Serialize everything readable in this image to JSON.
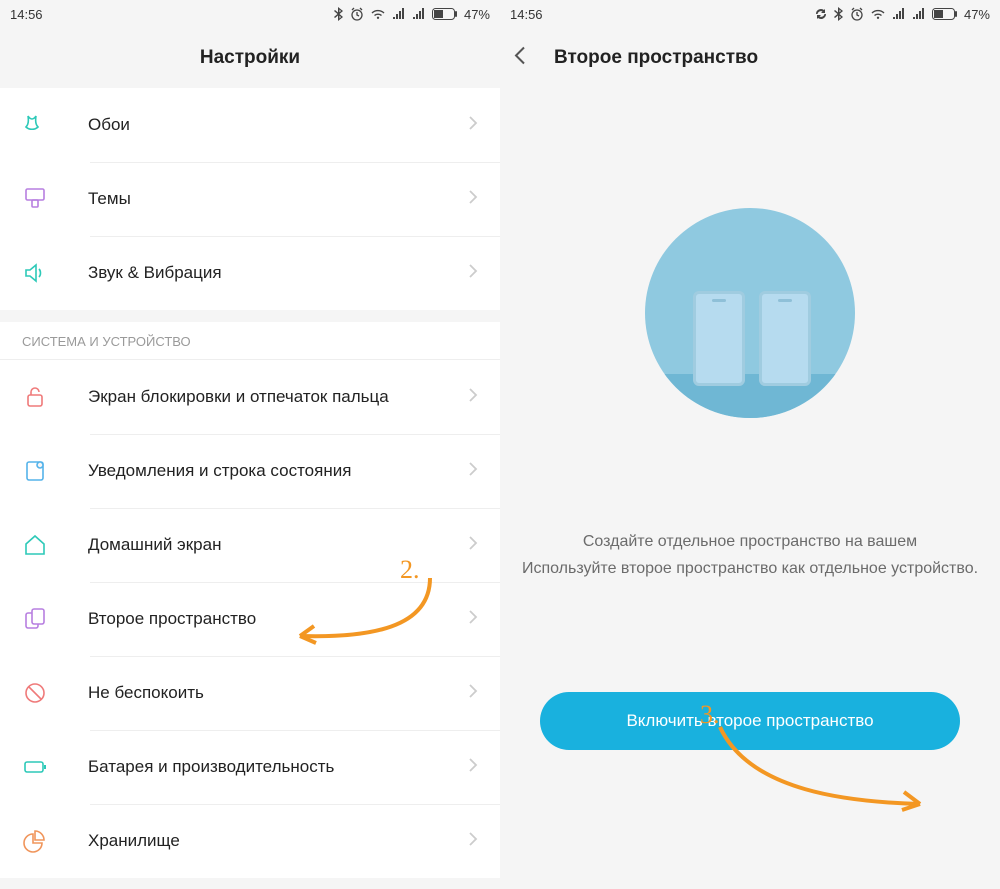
{
  "left": {
    "status": {
      "time": "14:56",
      "battery": "47%"
    },
    "title": "Настройки",
    "items_top": [
      {
        "label": "Обои",
        "icon": "wallpaper"
      },
      {
        "label": "Темы",
        "icon": "themes"
      },
      {
        "label": "Звук & Вибрация",
        "icon": "sound"
      }
    ],
    "section_label": "СИСТЕМА И УСТРОЙСТВО",
    "items_system": [
      {
        "label": "Экран блокировки и отпечаток пальца",
        "icon": "lock"
      },
      {
        "label": "Уведомления и строка состояния",
        "icon": "notif"
      },
      {
        "label": "Домашний экран",
        "icon": "home"
      },
      {
        "label": "Второе пространство",
        "icon": "second"
      },
      {
        "label": "Не беспокоить",
        "icon": "dnd"
      },
      {
        "label": "Батарея и производительность",
        "icon": "battery"
      },
      {
        "label": "Хранилище",
        "icon": "storage"
      }
    ]
  },
  "right": {
    "status": {
      "time": "14:56",
      "battery": "47%"
    },
    "title": "Второе пространство",
    "desc_line1": "Создайте отдельное пространство на вашем",
    "desc_line2": "Используйте второе пространство как отдельное устройство.",
    "cta": "Включить второе пространство"
  },
  "annotations": {
    "num2": "2.",
    "num3": "3."
  }
}
